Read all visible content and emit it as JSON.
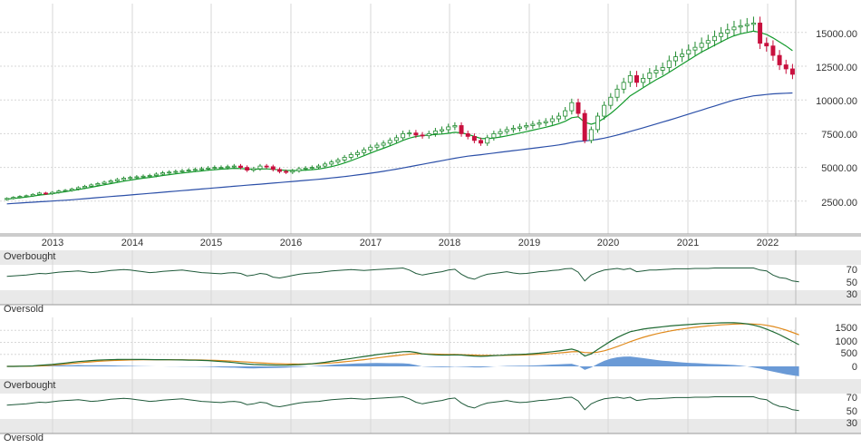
{
  "colors": {
    "up": "#1f8a2e",
    "down": "#c8103e",
    "ma_fast": "#129a2b",
    "ma_slow": "#2b4fa8",
    "osc": "#1f5a3a",
    "macd": "#1f6a33",
    "signal": "#e08a1c",
    "hist": "#6a9ad6",
    "band": "#e9e9e9",
    "grid": "#d7d7d7"
  },
  "panels": {
    "rsi1": {
      "overbought": "Overbought",
      "oversold": "Oversold",
      "ticks": [
        "70",
        "50",
        "30"
      ]
    },
    "rsi2": {
      "overbought": "Overbought",
      "oversold": "Oversold",
      "ticks": [
        "70",
        "50",
        "30"
      ]
    },
    "macd": {
      "ticks": [
        "1500",
        "1000",
        "500",
        "0"
      ]
    }
  },
  "chart_data": [
    {
      "type": "candlestick",
      "x_labels": [
        "2013",
        "2014",
        "2015",
        "2016",
        "2017",
        "2018",
        "2019",
        "2020",
        "2021",
        "2022"
      ],
      "y_ticks": [
        "15000.00",
        "12500.00",
        "10000.00",
        "7500.00",
        "5000.00",
        "2500.00"
      ],
      "ylim": [
        0,
        17000
      ],
      "grid": true,
      "close": [
        2700,
        2780,
        2850,
        2900,
        3000,
        3100,
        3050,
        3150,
        3250,
        3300,
        3400,
        3500,
        3600,
        3700,
        3800,
        3900,
        4000,
        4100,
        4200,
        4250,
        4300,
        4350,
        4400,
        4500,
        4600,
        4650,
        4700,
        4750,
        4800,
        4850,
        4900,
        4950,
        5000,
        5000,
        5050,
        5100,
        5000,
        4800,
        4900,
        5100,
        5050,
        4850,
        4700,
        4650,
        4750,
        4900,
        4950,
        5000,
        5100,
        5250,
        5400,
        5550,
        5750,
        5950,
        6100,
        6300,
        6500,
        6650,
        6800,
        7000,
        7200,
        7500,
        7550,
        7400,
        7350,
        7500,
        7700,
        7800,
        8000,
        8100,
        7500,
        7300,
        7000,
        6800,
        7200,
        7500,
        7650,
        7800,
        7900,
        8000,
        8100,
        8200,
        8300,
        8400,
        8600,
        8800,
        9200,
        9800,
        9000,
        7000,
        7800,
        8800,
        9600,
        10200,
        10800,
        11300,
        11800,
        11300,
        11600,
        12000,
        12200,
        12400,
        12900,
        13200,
        13400,
        13700,
        13900,
        14200,
        14400,
        14700,
        14950,
        15200,
        15400,
        15500,
        15600,
        15700,
        14200,
        14000,
        13300,
        12600,
        12300,
        11900
      ],
      "series": [
        {
          "name": "",
          "role": "fast_ma",
          "values": [
            2650,
            2700,
            2750,
            2800,
            2870,
            2950,
            3000,
            3060,
            3130,
            3200,
            3280,
            3360,
            3440,
            3530,
            3620,
            3710,
            3800,
            3890,
            3980,
            4060,
            4130,
            4200,
            4260,
            4330,
            4400,
            4460,
            4520,
            4580,
            4640,
            4690,
            4740,
            4790,
            4830,
            4870,
            4900,
            4930,
            4920,
            4880,
            4870,
            4880,
            4890,
            4860,
            4820,
            4780,
            4770,
            4780,
            4800,
            4830,
            4880,
            4960,
            5060,
            5180,
            5330,
            5500,
            5680,
            5870,
            6060,
            6240,
            6420,
            6600,
            6790,
            7000,
            7170,
            7290,
            7360,
            7400,
            7440,
            7470,
            7530,
            7600,
            7560,
            7450,
            7300,
            7150,
            7130,
            7180,
            7250,
            7340,
            7440,
            7550,
            7650,
            7760,
            7870,
            7980,
            8100,
            8240,
            8420,
            8680,
            8750,
            8350,
            8200,
            8350,
            8650,
            9000,
            9400,
            9850,
            10300,
            10600,
            10900,
            11200,
            11500,
            11750,
            12050,
            12350,
            12650,
            12950,
            13250,
            13550,
            13800,
            14050,
            14300,
            14550,
            14750,
            14900,
            15000,
            15100,
            15000,
            14850,
            14600,
            14300,
            14000,
            13650
          ]
        },
        {
          "name": "",
          "role": "slow_ma",
          "values": [
            2300,
            2330,
            2360,
            2390,
            2420,
            2450,
            2480,
            2510,
            2540,
            2570,
            2600,
            2640,
            2680,
            2720,
            2760,
            2800,
            2840,
            2880,
            2920,
            2960,
            3000,
            3040,
            3080,
            3120,
            3160,
            3200,
            3240,
            3280,
            3320,
            3360,
            3400,
            3440,
            3480,
            3520,
            3560,
            3600,
            3640,
            3680,
            3720,
            3760,
            3800,
            3840,
            3880,
            3920,
            3960,
            4000,
            4040,
            4080,
            4120,
            4170,
            4220,
            4270,
            4320,
            4380,
            4440,
            4500,
            4570,
            4640,
            4710,
            4790,
            4870,
            4960,
            5050,
            5140,
            5230,
            5320,
            5410,
            5500,
            5590,
            5680,
            5760,
            5830,
            5890,
            5940,
            6000,
            6060,
            6120,
            6180,
            6240,
            6300,
            6360,
            6420,
            6480,
            6540,
            6600,
            6670,
            6750,
            6850,
            6930,
            6960,
            7010,
            7080,
            7170,
            7280,
            7400,
            7530,
            7670,
            7800,
            7940,
            8080,
            8220,
            8360,
            8500,
            8650,
            8800,
            8950,
            9100,
            9250,
            9400,
            9550,
            9700,
            9850,
            9990,
            10100,
            10200,
            10300,
            10350,
            10400,
            10450,
            10480,
            10500,
            10520
          ]
        }
      ]
    },
    {
      "type": "line",
      "values": [
        55,
        56,
        57,
        58,
        60,
        62,
        61,
        63,
        65,
        66,
        67,
        68,
        66,
        64,
        65,
        67,
        69,
        70,
        71,
        70,
        68,
        66,
        64,
        65,
        67,
        68,
        69,
        70,
        68,
        66,
        64,
        63,
        62,
        61,
        63,
        64,
        62,
        56,
        58,
        62,
        60,
        53,
        51,
        54,
        57,
        60,
        62,
        63,
        64,
        66,
        68,
        69,
        70,
        71,
        70,
        69,
        70,
        71,
        72,
        73,
        74,
        75,
        70,
        62,
        58,
        61,
        64,
        66,
        70,
        72,
        60,
        52,
        48,
        55,
        60,
        62,
        64,
        66,
        63,
        61,
        62,
        64,
        66,
        67,
        69,
        70,
        73,
        74,
        65,
        44,
        58,
        65,
        70,
        72,
        74,
        71,
        74,
        66,
        68,
        70,
        70,
        71,
        72,
        73,
        73,
        73,
        74,
        74,
        74,
        75,
        75,
        75,
        75,
        75,
        75,
        75,
        70,
        68,
        58,
        52,
        50,
        44,
        42
      ],
      "ylim": [
        0,
        100
      ]
    },
    {
      "type": "line",
      "series": [
        {
          "name": "",
          "role": "macd",
          "values": [
            0,
            0,
            5,
            10,
            20,
            40,
            60,
            80,
            110,
            140,
            170,
            200,
            220,
            240,
            260,
            270,
            280,
            285,
            290,
            290,
            288,
            285,
            282,
            280,
            278,
            275,
            272,
            268,
            262,
            255,
            248,
            240,
            220,
            200,
            180,
            160,
            130,
            100,
            80,
            70,
            60,
            55,
            50,
            50,
            60,
            70,
            90,
            110,
            140,
            170,
            210,
            250,
            290,
            330,
            370,
            410,
            450,
            490,
            520,
            550,
            580,
            610,
            620,
            580,
            520,
            500,
            480,
            470,
            470,
            480,
            470,
            450,
            430,
            420,
            430,
            450,
            460,
            480,
            490,
            500,
            510,
            530,
            550,
            580,
            610,
            640,
            680,
            720,
            640,
            430,
            520,
            700,
            880,
            1050,
            1200,
            1330,
            1440,
            1500,
            1550,
            1590,
            1620,
            1650,
            1680,
            1700,
            1720,
            1740,
            1760,
            1780,
            1790,
            1800,
            1810,
            1815,
            1815,
            1800,
            1770,
            1720,
            1650,
            1550,
            1440,
            1320,
            1180,
            1040,
            900
          ]
        },
        {
          "name": "",
          "role": "signal",
          "values": [
            0,
            0,
            2,
            5,
            10,
            20,
            35,
            50,
            70,
            95,
            120,
            145,
            170,
            190,
            210,
            225,
            240,
            250,
            260,
            268,
            272,
            276,
            278,
            279,
            279,
            278,
            277,
            275,
            272,
            268,
            264,
            258,
            250,
            240,
            228,
            214,
            198,
            180,
            162,
            146,
            132,
            120,
            110,
            102,
            98,
            96,
            99,
            104,
            114,
            127,
            145,
            166,
            191,
            219,
            249,
            281,
            315,
            350,
            384,
            417,
            449,
            481,
            509,
            523,
            522,
            518,
            511,
            503,
            496,
            493,
            488,
            481,
            471,
            461,
            455,
            454,
            455,
            460,
            466,
            473,
            481,
            491,
            503,
            518,
            536,
            557,
            581,
            609,
            615,
            578,
            566,
            593,
            650,
            730,
            824,
            925,
            1028,
            1122,
            1208,
            1284,
            1351,
            1411,
            1465,
            1512,
            1554,
            1591,
            1625,
            1656,
            1683,
            1706,
            1727,
            1744,
            1758,
            1767,
            1769,
            1764,
            1746,
            1711,
            1659,
            1591,
            1509,
            1415,
            1312
          ]
        },
        {
          "name": "",
          "role": "histogram",
          "values": [
            0,
            0,
            3,
            5,
            10,
            20,
            25,
            30,
            40,
            45,
            50,
            55,
            50,
            50,
            50,
            45,
            40,
            35,
            30,
            22,
            16,
            9,
            4,
            1,
            -1,
            -3,
            -5,
            -7,
            -10,
            -13,
            -16,
            -18,
            -30,
            -40,
            -48,
            -54,
            -68,
            -80,
            -82,
            -76,
            -72,
            -65,
            -60,
            -52,
            -38,
            -26,
            -9,
            6,
            26,
            43,
            65,
            84,
            99,
            111,
            121,
            129,
            135,
            140,
            136,
            133,
            131,
            129,
            111,
            57,
            -2,
            -18,
            -31,
            -33,
            -26,
            -13,
            -18,
            -31,
            -41,
            -41,
            -25,
            -4,
            5,
            20,
            24,
            27,
            29,
            39,
            47,
            62,
            74,
            83,
            99,
            111,
            25,
            -148,
            -46,
            107,
            230,
            320,
            376,
            405,
            412,
            378,
            342,
            306,
            269,
            239,
            215,
            188,
            166,
            149,
            135,
            124,
            107,
            94,
            83,
            71,
            57,
            33,
            1,
            -44,
            -96,
            -161,
            -219,
            -271,
            -329,
            -375,
            -412
          ]
        }
      ],
      "ylim": [
        -500,
        2000
      ]
    },
    {
      "type": "line",
      "values": [
        55,
        56,
        57,
        58,
        60,
        62,
        61,
        63,
        65,
        66,
        67,
        68,
        66,
        64,
        65,
        67,
        69,
        70,
        71,
        70,
        68,
        66,
        64,
        65,
        67,
        68,
        69,
        70,
        68,
        66,
        64,
        63,
        62,
        61,
        63,
        64,
        62,
        56,
        58,
        62,
        60,
        53,
        51,
        54,
        57,
        60,
        62,
        63,
        64,
        66,
        68,
        69,
        70,
        71,
        70,
        69,
        70,
        71,
        72,
        73,
        74,
        75,
        70,
        62,
        58,
        61,
        64,
        66,
        70,
        72,
        60,
        52,
        48,
        55,
        60,
        62,
        64,
        66,
        63,
        61,
        62,
        64,
        66,
        67,
        69,
        70,
        73,
        74,
        65,
        44,
        58,
        65,
        70,
        72,
        74,
        71,
        74,
        66,
        68,
        70,
        70,
        71,
        72,
        73,
        73,
        73,
        74,
        74,
        74,
        75,
        75,
        75,
        75,
        75,
        75,
        75,
        70,
        68,
        58,
        52,
        50,
        44,
        42
      ],
      "ylim": [
        0,
        100
      ]
    }
  ]
}
